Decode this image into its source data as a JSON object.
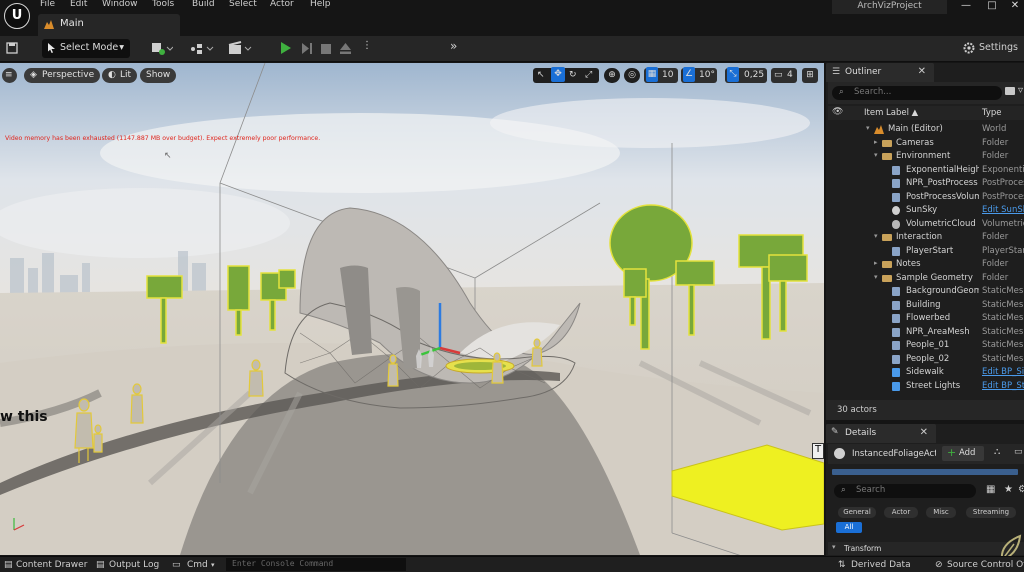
{
  "menu": {
    "items": [
      "File",
      "Edit",
      "Window",
      "Tools",
      "Build",
      "Select",
      "Actor",
      "Help"
    ],
    "project_name": "ArchVizProject"
  },
  "tab": {
    "label": "Main"
  },
  "toolbar": {
    "select_mode": "Select Mode",
    "settings": "Settings"
  },
  "viewport": {
    "perspective": "Perspective",
    "lit": "Lit",
    "show": "Show",
    "grid_snap": "10",
    "rotation_snap": "10°",
    "scale_snap": "0,25",
    "camera_speed": "4",
    "warning": "Video memory has been exhausted (1147.887 MB over budget). Expect extremely poor performance.",
    "overlay_text": "w this"
  },
  "outliner": {
    "title": "Outliner",
    "search_placeholder": "Search...",
    "col_label": "Item Label ▲",
    "col_type": "Type",
    "rows": [
      {
        "label": "Main (Editor)",
        "type": "World"
      },
      {
        "label": "Cameras",
        "type": "Folder"
      },
      {
        "label": "Environment",
        "type": "Folder"
      },
      {
        "label": "ExponentialHeightFog",
        "type": "ExponentialHeightFog"
      },
      {
        "label": "NPR_PostProcess",
        "type": "PostProcessVolume"
      },
      {
        "label": "PostProcessVolume",
        "type": "PostProcessVolume"
      },
      {
        "label": "SunSky",
        "type": "Edit SunSky"
      },
      {
        "label": "VolumetricCloud",
        "type": "VolumetricCloud"
      },
      {
        "label": "Interaction",
        "type": "Folder"
      },
      {
        "label": "PlayerStart",
        "type": "PlayerStart"
      },
      {
        "label": "Notes",
        "type": "Folder"
      },
      {
        "label": "Sample Geometry",
        "type": "Folder"
      },
      {
        "label": "BackgroundGeometry",
        "type": "StaticMeshActor"
      },
      {
        "label": "Building",
        "type": "StaticMeshActor"
      },
      {
        "label": "Flowerbed",
        "type": "StaticMeshActor"
      },
      {
        "label": "NPR_AreaMesh",
        "type": "StaticMeshActor"
      },
      {
        "label": "People_01",
        "type": "StaticMeshActor"
      },
      {
        "label": "People_02",
        "type": "StaticMeshActor"
      },
      {
        "label": "Sidewalk",
        "type": "Edit BP_Sidewalk"
      },
      {
        "label": "Street Lights",
        "type": "Edit BP_StreetLights"
      }
    ],
    "actor_count": "30 actors"
  },
  "details": {
    "title": "Details",
    "selected": "InstancedFoliageActor",
    "add_label": "Add",
    "search_placeholder": "Search",
    "filters": [
      "General",
      "Actor",
      "Misc",
      "Streaming"
    ],
    "all_label": "All",
    "section": "Transform"
  },
  "statusbar": {
    "content_drawer": "Content Drawer",
    "output_log": "Output Log",
    "cmd": "Cmd",
    "console_placeholder": "Enter Console Command",
    "derived_data": "Derived Data",
    "source_control": "Source Control Off"
  },
  "colors": {
    "accent_blue": "#1a6fd6",
    "play_green": "#3fb03f",
    "tree_green": "#7fae3a",
    "selection_yellow": "#f2e81c",
    "warning_red": "#e0241c"
  }
}
